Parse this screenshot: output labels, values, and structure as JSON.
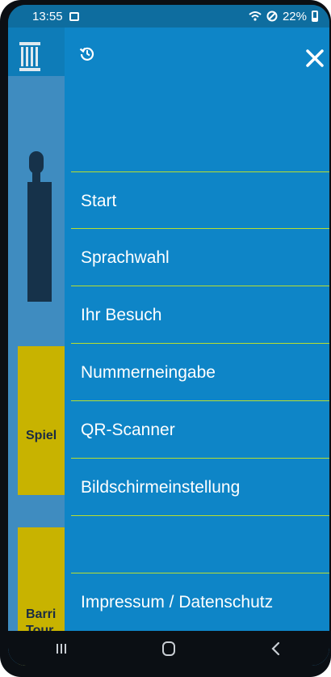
{
  "status_bar": {
    "time": "13:55",
    "battery_text": "22%",
    "icons": [
      "message-icon",
      "wifi-icon",
      "do-not-disturb-icon",
      "battery-icon"
    ]
  },
  "background": {
    "card1_text": "Spiel",
    "card2_text": "Barri Tour",
    "logo_icon": "pillar-icon"
  },
  "drawer": {
    "history_icon": "history-icon",
    "close_icon": "close-icon",
    "items": [
      {
        "label": "Start"
      },
      {
        "label": "Sprachwahl"
      },
      {
        "label": "Ihr Besuch"
      },
      {
        "label": "Nummerneingabe"
      },
      {
        "label": "QR-Scanner"
      },
      {
        "label": "Bildschirmeinstellung"
      }
    ],
    "footer_label": "Impressum / Datenschutz"
  },
  "navbar": {
    "icons": [
      "recent-apps-icon",
      "home-icon",
      "back-icon"
    ]
  },
  "colors": {
    "drawer_bg": "#0e85c7",
    "divider": "#b7de2f",
    "card_yellow": "#c8b300"
  }
}
